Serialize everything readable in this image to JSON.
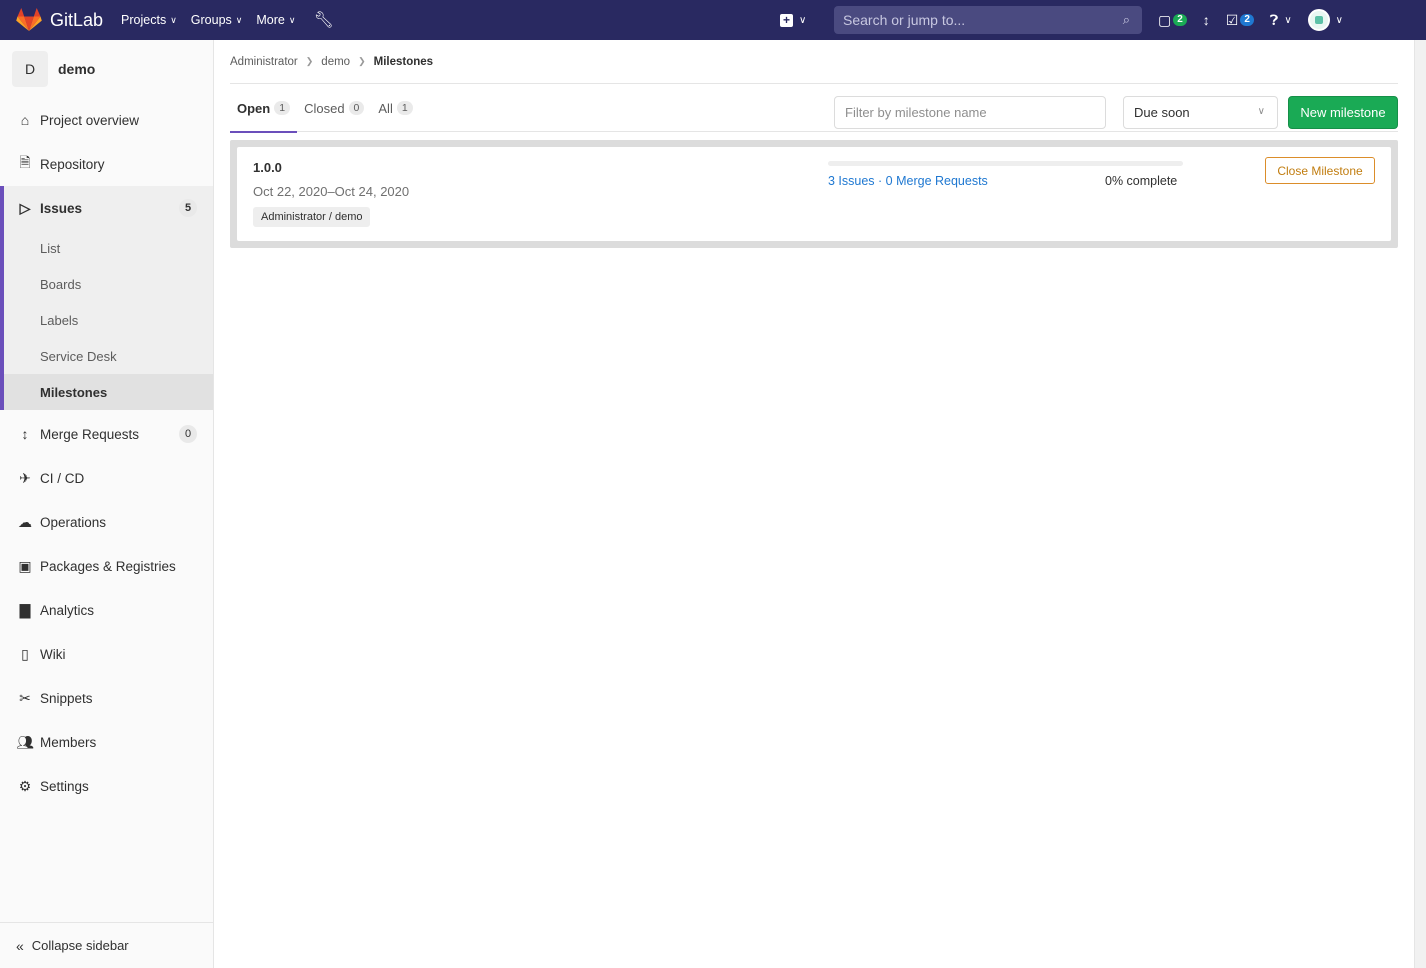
{
  "navbar": {
    "brand": "GitLab",
    "links": [
      {
        "label": "Projects"
      },
      {
        "label": "Groups"
      },
      {
        "label": "More"
      }
    ],
    "search_placeholder": "Search or jump to...",
    "issues_count": "2",
    "todos_count": "2"
  },
  "sidebar": {
    "project_initial": "D",
    "project_name": "demo",
    "items_top": [
      {
        "label": "Project overview",
        "icon": "home-icon"
      },
      {
        "label": "Repository",
        "icon": "document-icon"
      }
    ],
    "issues": {
      "label": "Issues",
      "count": "5",
      "sub": [
        {
          "label": "List"
        },
        {
          "label": "Boards"
        },
        {
          "label": "Labels"
        },
        {
          "label": "Service Desk"
        },
        {
          "label": "Milestones"
        }
      ]
    },
    "items_bottom": [
      {
        "label": "Merge Requests",
        "count": "0"
      },
      {
        "label": "CI / CD"
      },
      {
        "label": "Operations"
      },
      {
        "label": "Packages & Registries"
      },
      {
        "label": "Analytics"
      },
      {
        "label": "Wiki"
      },
      {
        "label": "Snippets"
      },
      {
        "label": "Members"
      },
      {
        "label": "Settings"
      }
    ],
    "collapse_label": "Collapse sidebar"
  },
  "breadcrumb": {
    "items": [
      "Administrator",
      "demo"
    ],
    "current": "Milestones"
  },
  "tabs": [
    {
      "label": "Open",
      "count": "1"
    },
    {
      "label": "Closed",
      "count": "0"
    },
    {
      "label": "All",
      "count": "1"
    }
  ],
  "filter_placeholder": "Filter by milestone name",
  "sort_selected": "Due soon",
  "new_milestone_label": "New milestone",
  "milestone": {
    "title": "1.0.0",
    "dates": "Oct 22, 2020–Oct 24, 2020",
    "project": "Administrator / demo",
    "progress": 0,
    "issues_link": "3 Issues",
    "separator": " · ",
    "mr_link": "0 Merge Requests",
    "complete_text": "0% complete",
    "close_label": "Close Milestone"
  }
}
